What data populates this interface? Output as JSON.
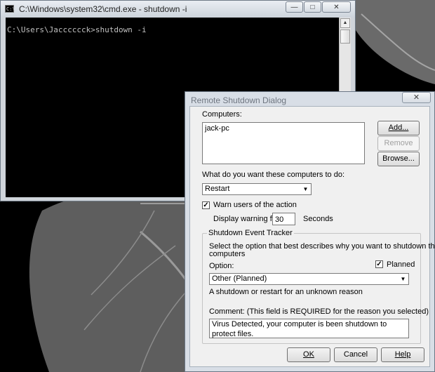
{
  "cmd_window": {
    "title": "C:\\Windows\\system32\\cmd.exe - shutdown  -i",
    "icon": "cmd-icon",
    "prompt_line": "C:\\Users\\Jacccccck>shutdown -i"
  },
  "dialog": {
    "title": "Remote Shutdown Dialog",
    "computers_label": "Computers:",
    "computers": [
      "jack-pc"
    ],
    "add_label": "Add...",
    "remove_label": "Remove",
    "browse_label": "Browse...",
    "action_label": "What do you want these computers to do:",
    "action_value": "Restart",
    "warn_label": "Warn users of the action",
    "warn_checked": true,
    "display_warning_label": "Display warning for",
    "warning_seconds": "30",
    "seconds_label": "Seconds",
    "tracker": {
      "legend": "Shutdown Event Tracker",
      "description_1": "Select the option that best describes why you want to shutdown the",
      "description_2": "computers",
      "option_label": "Option:",
      "planned_label": "Planned",
      "planned_checked": true,
      "option_value": "Other (Planned)",
      "option_description": "A shutdown or restart for an unknown reason",
      "comment_label": "Comment:  (This field is REQUIRED for the reason you selected)",
      "comment_value": "Virus Detected, your computer is been shutdown to protect files."
    },
    "ok_label": "OK",
    "cancel_label": "Cancel",
    "help_label": "Help"
  }
}
